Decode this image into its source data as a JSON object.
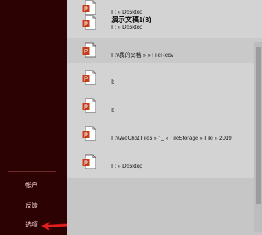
{
  "sidebar": {
    "items": [
      {
        "label": "帐户"
      },
      {
        "label": "反馈"
      },
      {
        "label": "选项"
      }
    ]
  },
  "files": [
    {
      "name": "",
      "path": "F: » Desktop"
    },
    {
      "name": "演示文稿1(3)",
      "path": "F: » Desktop"
    },
    {
      "name": "",
      "path": "F:\\\\我的文档 »                    » FileRecv"
    },
    {
      "name": "",
      "path": "I:"
    },
    {
      "name": "",
      "path": "I:"
    },
    {
      "name": "",
      "path": "F:\\\\WeChat Files » '          _ » FileStorage » File » 2019"
    },
    {
      "name": "",
      "path": "F: » Desktop"
    }
  ],
  "colors": {
    "sidebar_bg": "#2c0202",
    "content_bg": "#d3d3d3",
    "ppt_icon": "#c43e1c",
    "arrow": "#e22222"
  }
}
